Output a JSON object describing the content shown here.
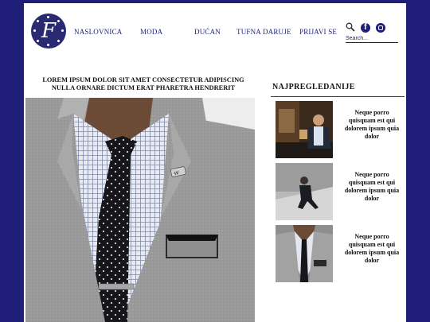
{
  "brand": {
    "logo_letter": "F"
  },
  "nav": [
    "NASLOVNICA",
    "MODA",
    "DUĆAN",
    "TUFNA DARUJE",
    "PRIJAVI SE"
  ],
  "header": {
    "search_placeholder": "Search...",
    "icons": [
      "search-icon",
      "facebook-icon",
      "instagram-icon"
    ]
  },
  "article": {
    "title_line1": "LOREM IPSUM DOLOR SIT AMET CONSECTETUR ADIPISCING",
    "title_line2": "NULLA ORNARE DICTUM ERAT PHARETRA HENDRERIT"
  },
  "sidebar": {
    "title": "NAJPREGLEDANIJE",
    "items": [
      {
        "text": "Neque porro quisquam est qui dolorem ipsum quia dolor"
      },
      {
        "text": "Neque porro quisquam est qui dolorem ipsum quia dolor"
      },
      {
        "text": "Neque porro quisquam est qui dolorem ipsum quia dolor"
      }
    ]
  },
  "colors": {
    "background": "#1f1f7a",
    "accent": "#1f1f7a",
    "page": "#ffffff"
  }
}
